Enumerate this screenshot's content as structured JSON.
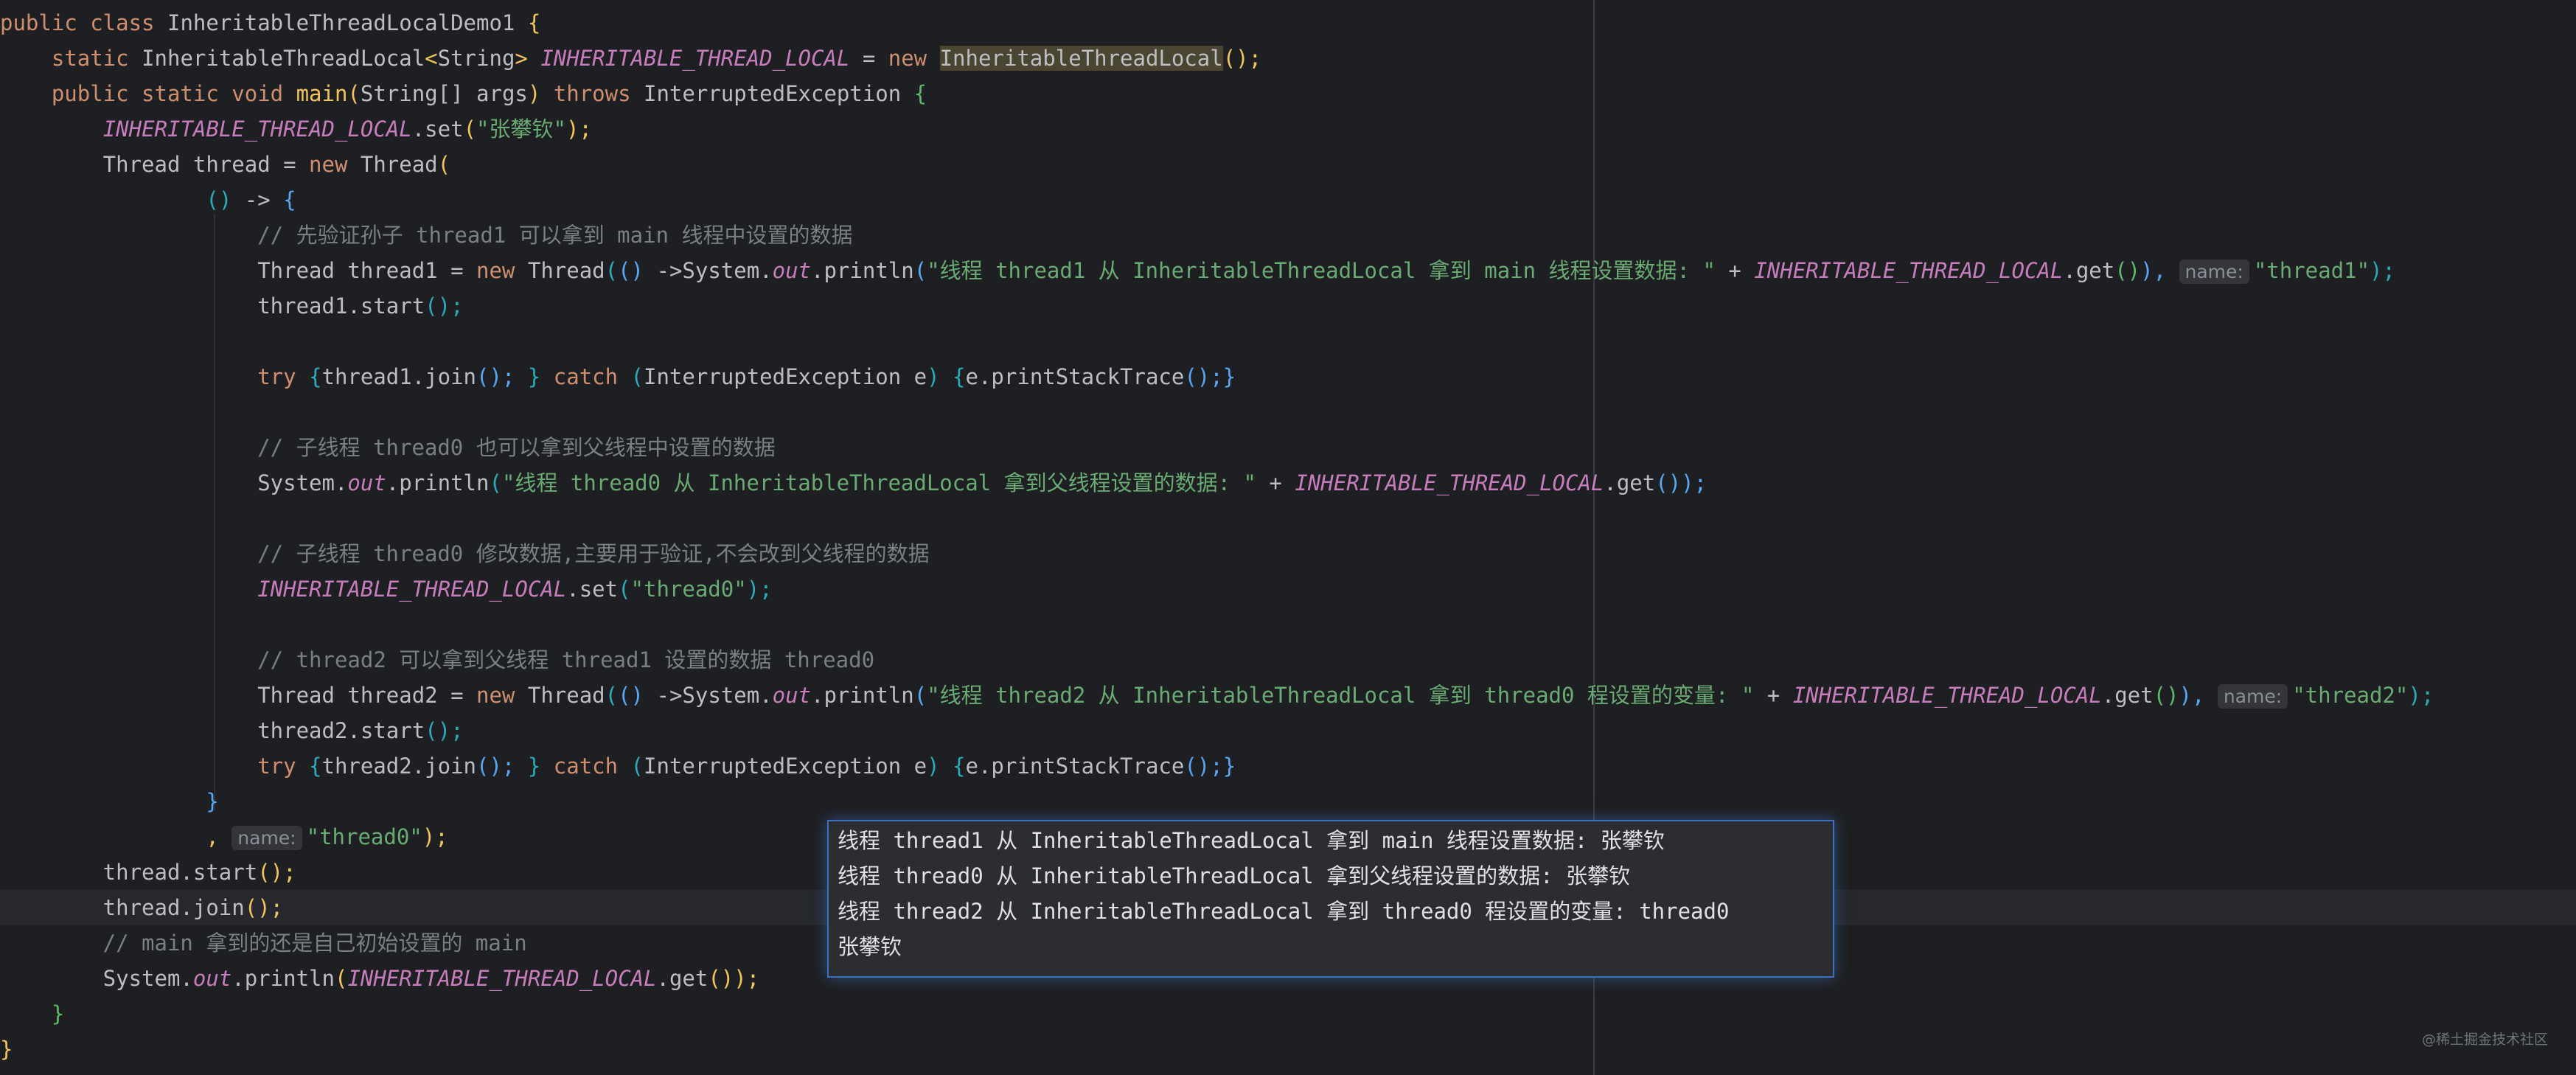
{
  "code": {
    "lines": [
      {
        "tokens": [
          {
            "t": "public class ",
            "c": "kw"
          },
          {
            "t": "InheritableThreadLocalDemo1 ",
            "c": "pl"
          },
          {
            "t": "{",
            "c": "b1"
          }
        ]
      },
      {
        "tokens": [
          {
            "t": "    static ",
            "c": "kw"
          },
          {
            "t": "InheritableThreadLocal",
            "c": "pl"
          },
          {
            "t": "<",
            "c": "b1"
          },
          {
            "t": "String",
            "c": "pl"
          },
          {
            "t": "> ",
            "c": "b1"
          },
          {
            "t": "INHERITABLE_THREAD_LOCAL",
            "c": "st"
          },
          {
            "t": " = ",
            "c": "pl"
          },
          {
            "t": "new ",
            "c": "kw"
          },
          {
            "t": "InheritableThreadLocal",
            "c": "pl hl"
          },
          {
            "t": "();",
            "c": "b1"
          }
        ]
      },
      {
        "tokens": [
          {
            "t": "    public static void ",
            "c": "kw"
          },
          {
            "t": "main",
            "c": "b1"
          },
          {
            "t": "(",
            "c": "b1"
          },
          {
            "t": "String[] args",
            "c": "pl"
          },
          {
            "t": ") ",
            "c": "b1"
          },
          {
            "t": "throws ",
            "c": "kw"
          },
          {
            "t": "InterruptedException ",
            "c": "pl"
          },
          {
            "t": "{",
            "c": "b5"
          }
        ]
      },
      {
        "tokens": [
          {
            "t": "        ",
            "c": "pl"
          },
          {
            "t": "INHERITABLE_THREAD_LOCAL",
            "c": "st"
          },
          {
            "t": ".set",
            "c": "pl"
          },
          {
            "t": "(",
            "c": "b1"
          },
          {
            "t": "\"张攀钦\"",
            "c": "str"
          },
          {
            "t": ");",
            "c": "b1"
          }
        ]
      },
      {
        "tokens": [
          {
            "t": "        Thread thread = ",
            "c": "pl"
          },
          {
            "t": "new ",
            "c": "kw"
          },
          {
            "t": "Thread",
            "c": "pl"
          },
          {
            "t": "(",
            "c": "b1"
          }
        ]
      },
      {
        "tokens": [
          {
            "t": "                ",
            "c": "pl"
          },
          {
            "t": "() ",
            "c": "b3"
          },
          {
            "t": "-> ",
            "c": "pl"
          },
          {
            "t": "{",
            "c": "b4"
          }
        ]
      },
      {
        "tokens": [
          {
            "t": "                    // 先验证孙子 thread1 可以拿到 main 线程中设置的数据",
            "c": "cm"
          }
        ]
      },
      {
        "tokens": [
          {
            "t": "                    Thread thread1 = ",
            "c": "pl"
          },
          {
            "t": "new ",
            "c": "kw"
          },
          {
            "t": "Thread",
            "c": "pl"
          },
          {
            "t": "(",
            "c": "b3"
          },
          {
            "t": "() ",
            "c": "b4"
          },
          {
            "t": "->System.",
            "c": "pl"
          },
          {
            "t": "out",
            "c": "ital"
          },
          {
            "t": ".println",
            "c": "pl"
          },
          {
            "t": "(",
            "c": "b4"
          },
          {
            "t": "\"线程 thread1 从 InheritableThreadLocal 拿到 main 线程设置数据: \"",
            "c": "str"
          },
          {
            "t": " + ",
            "c": "pl"
          },
          {
            "t": "INHERITABLE_THREAD_LOCAL",
            "c": "st"
          },
          {
            "t": ".get",
            "c": "pl"
          },
          {
            "t": "()",
            "c": "b5"
          },
          {
            "t": "), ",
            "c": "b4"
          },
          {
            "t": "name:",
            "c": "hint"
          },
          {
            "t": "\"thread1\"",
            "c": "str"
          },
          {
            "t": ");",
            "c": "b3"
          }
        ]
      },
      {
        "tokens": [
          {
            "t": "                    thread1.start",
            "c": "pl"
          },
          {
            "t": "();",
            "c": "b3"
          }
        ]
      },
      {
        "tokens": []
      },
      {
        "tokens": [
          {
            "t": "                    try ",
            "c": "kw"
          },
          {
            "t": "{",
            "c": "b3"
          },
          {
            "t": "thread1.join",
            "c": "pl"
          },
          {
            "t": "(); ",
            "c": "b4"
          },
          {
            "t": "} ",
            "c": "b3"
          },
          {
            "t": "catch ",
            "c": "kw"
          },
          {
            "t": "(",
            "c": "b3"
          },
          {
            "t": "InterruptedException e",
            "c": "pl"
          },
          {
            "t": ") ",
            "c": "b3"
          },
          {
            "t": "{",
            "c": "b3"
          },
          {
            "t": "e.printStackTrace",
            "c": "pl"
          },
          {
            "t": "();}",
            "c": "b4"
          }
        ]
      },
      {
        "tokens": []
      },
      {
        "tokens": [
          {
            "t": "                    // 子线程 thread0 也可以拿到父线程中设置的数据",
            "c": "cm"
          }
        ]
      },
      {
        "tokens": [
          {
            "t": "                    System.",
            "c": "pl"
          },
          {
            "t": "out",
            "c": "ital"
          },
          {
            "t": ".println",
            "c": "pl"
          },
          {
            "t": "(",
            "c": "b3"
          },
          {
            "t": "\"线程 thread0 从 InheritableThreadLocal 拿到父线程设置的数据: \"",
            "c": "str"
          },
          {
            "t": " + ",
            "c": "pl"
          },
          {
            "t": "INHERITABLE_THREAD_LOCAL",
            "c": "st"
          },
          {
            "t": ".get",
            "c": "pl"
          },
          {
            "t": "());",
            "c": "b4"
          }
        ]
      },
      {
        "tokens": []
      },
      {
        "tokens": [
          {
            "t": "                    // 子线程 thread0 修改数据,主要用于验证,不会改到父线程的数据",
            "c": "cm"
          }
        ]
      },
      {
        "tokens": [
          {
            "t": "                    ",
            "c": "pl"
          },
          {
            "t": "INHERITABLE_THREAD_LOCAL",
            "c": "st"
          },
          {
            "t": ".set",
            "c": "pl"
          },
          {
            "t": "(",
            "c": "b3"
          },
          {
            "t": "\"thread0\"",
            "c": "str"
          },
          {
            "t": ");",
            "c": "b3"
          }
        ]
      },
      {
        "tokens": []
      },
      {
        "tokens": [
          {
            "t": "                    // thread2 可以拿到父线程 thread1 设置的数据 thread0",
            "c": "cm"
          }
        ]
      },
      {
        "tokens": [
          {
            "t": "                    Thread thread2 = ",
            "c": "pl"
          },
          {
            "t": "new ",
            "c": "kw"
          },
          {
            "t": "Thread",
            "c": "pl"
          },
          {
            "t": "(",
            "c": "b3"
          },
          {
            "t": "() ",
            "c": "b4"
          },
          {
            "t": "->System.",
            "c": "pl"
          },
          {
            "t": "out",
            "c": "ital"
          },
          {
            "t": ".println",
            "c": "pl"
          },
          {
            "t": "(",
            "c": "b4"
          },
          {
            "t": "\"线程 thread2 从 InheritableThreadLocal 拿到 thread0 程设置的变量: \"",
            "c": "str"
          },
          {
            "t": " + ",
            "c": "pl"
          },
          {
            "t": "INHERITABLE_THREAD_LOCAL",
            "c": "st"
          },
          {
            "t": ".get",
            "c": "pl"
          },
          {
            "t": "()",
            "c": "b5"
          },
          {
            "t": "), ",
            "c": "b4"
          },
          {
            "t": "name:",
            "c": "hint"
          },
          {
            "t": "\"thread2\"",
            "c": "str"
          },
          {
            "t": ");",
            "c": "b3"
          }
        ]
      },
      {
        "tokens": [
          {
            "t": "                    thread2.start",
            "c": "pl"
          },
          {
            "t": "();",
            "c": "b3"
          }
        ]
      },
      {
        "tokens": [
          {
            "t": "                    try ",
            "c": "kw"
          },
          {
            "t": "{",
            "c": "b3"
          },
          {
            "t": "thread2.join",
            "c": "pl"
          },
          {
            "t": "(); ",
            "c": "b4"
          },
          {
            "t": "} ",
            "c": "b3"
          },
          {
            "t": "catch ",
            "c": "kw"
          },
          {
            "t": "(",
            "c": "b3"
          },
          {
            "t": "InterruptedException e",
            "c": "pl"
          },
          {
            "t": ") ",
            "c": "b3"
          },
          {
            "t": "{",
            "c": "b3"
          },
          {
            "t": "e.printStackTrace",
            "c": "pl"
          },
          {
            "t": "();}",
            "c": "b4"
          }
        ]
      },
      {
        "tokens": [
          {
            "t": "                ",
            "c": "pl"
          },
          {
            "t": "}",
            "c": "b4"
          }
        ]
      },
      {
        "tokens": [
          {
            "t": "                , ",
            "c": "b1"
          },
          {
            "t": "name:",
            "c": "hint"
          },
          {
            "t": "\"thread0\"",
            "c": "str"
          },
          {
            "t": ");",
            "c": "b1"
          }
        ]
      },
      {
        "tokens": [
          {
            "t": "        thread.start",
            "c": "pl"
          },
          {
            "t": "();",
            "c": "b1"
          }
        ]
      },
      {
        "tokens": [
          {
            "t": "        thread.join",
            "c": "pl"
          },
          {
            "t": "();",
            "c": "b1"
          }
        ],
        "current": true
      },
      {
        "tokens": [
          {
            "t": "        // main 拿到的还是自己初始设置的 main",
            "c": "cm"
          }
        ]
      },
      {
        "tokens": [
          {
            "t": "        System.",
            "c": "pl"
          },
          {
            "t": "out",
            "c": "ital"
          },
          {
            "t": ".println",
            "c": "pl"
          },
          {
            "t": "(",
            "c": "b1"
          },
          {
            "t": "INHERITABLE_THREAD_LOCAL",
            "c": "st"
          },
          {
            "t": ".get",
            "c": "pl"
          },
          {
            "t": "());",
            "c": "b1"
          }
        ]
      },
      {
        "tokens": [
          {
            "t": "    }",
            "c": "b5"
          }
        ]
      },
      {
        "tokens": [
          {
            "t": "}",
            "c": "b1"
          }
        ]
      }
    ]
  },
  "output_popup": {
    "lines": [
      "线程 thread1 从 InheritableThreadLocal 拿到 main 线程设置数据: 张攀钦",
      "线程 thread0 从 InheritableThreadLocal 拿到父线程设置的数据: 张攀钦",
      "线程 thread2 从 InheritableThreadLocal 拿到 thread0 程设置的变量: thread0",
      "张攀钦"
    ]
  },
  "watermark": "@稀土掘金技术社区"
}
